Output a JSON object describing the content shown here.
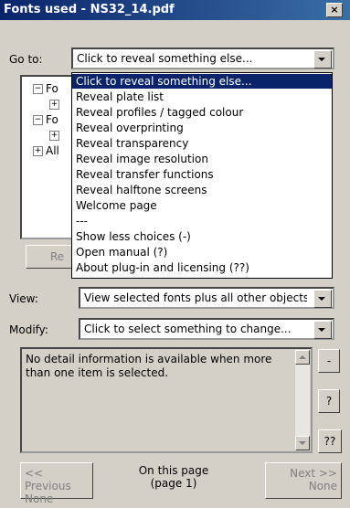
{
  "window": {
    "title": "Fonts used - NS32_14.pdf",
    "close_label": "×"
  },
  "goto": {
    "label": "Go to:",
    "value": "Click to reveal something else..."
  },
  "tree": {
    "rows": [
      {
        "expander": "−",
        "label": "Fo"
      },
      {
        "expander": "+",
        "label": ""
      },
      {
        "expander": "−",
        "label": "Fo"
      },
      {
        "expander": "+",
        "label": ""
      },
      {
        "expander": "+",
        "label": "All"
      }
    ]
  },
  "dropdown": {
    "items": [
      "Click to reveal something else...",
      "Reveal plate list",
      "Reveal profiles / tagged colour",
      "Reveal overprinting",
      "Reveal transparency",
      "Reveal image resolution",
      "Reveal transfer functions",
      "Reveal halftone screens",
      "Welcome page",
      "---",
      "Show less choices (-)",
      "Open manual (?)",
      "About plug-in and licensing (??)"
    ]
  },
  "reset_button": {
    "label": "Re"
  },
  "view": {
    "label": "View:",
    "value": "View selected fonts plus all other objects"
  },
  "modify": {
    "label": "Modify:",
    "value": "Click to select something to change..."
  },
  "detail": {
    "text": "No detail information is available when more than one item is selected."
  },
  "side_buttons": {
    "minus": "-",
    "help": "?",
    "about": "??"
  },
  "nav": {
    "previous": "<< Previous",
    "previous_sub": "None",
    "page_line1": "On this page",
    "page_line2": "(page 1)",
    "next": "Next >>",
    "next_sub": "None"
  }
}
